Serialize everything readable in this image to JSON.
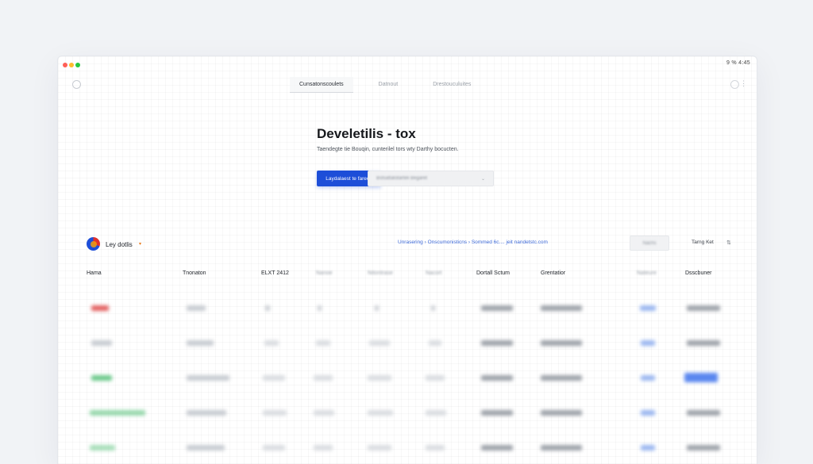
{
  "window": {
    "status_text": "9 %  4:45"
  },
  "topnav": {
    "tabs": [
      {
        "label": "Cunsatonscoulets",
        "active": true
      },
      {
        "label": "Datnout",
        "active": false
      },
      {
        "label": "Drestouculuites",
        "active": false
      }
    ]
  },
  "hero": {
    "title": "Develetilis - tox",
    "subtitle": "Taendegte tie Bouqin, cunterilel tors wty Darthy bocucten.",
    "primary_button": "Laydalaest te farech",
    "secondary_select": "Bstsattatotarteli Begaret"
  },
  "toolbar": {
    "title": "Ley dotlis",
    "breadcrumb": "Unrasering  ›  Onscumonisticns  ›  Sommed 6c....  jeit nandetstc.com",
    "button_label": "Nachs",
    "meta": "Tarng Ket",
    "meta_icon": "sort-icon"
  },
  "table": {
    "columns": [
      {
        "label": "Hama",
        "blurred": false
      },
      {
        "label": "Tnonaton",
        "blurred": false
      },
      {
        "label": "ELXT 2412",
        "blurred": false
      },
      {
        "label": "Nanoe",
        "blurred": true
      },
      {
        "label": "Nitontrase",
        "blurred": true
      },
      {
        "label": "Nacort",
        "blurred": true
      },
      {
        "label": "Dortall Sctum",
        "blurred": false
      },
      {
        "label": "Grentatior",
        "blurred": false
      },
      {
        "label": "Nateure",
        "blurred": true
      },
      {
        "label": "Dsscbuner",
        "blurred": false
      }
    ],
    "row_count": 5
  },
  "colors": {
    "accent": "#1d4ed8",
    "link": "#3f6bd9",
    "logo_red": "#e0312c",
    "logo_orange": "#f59e0b",
    "status_red": "#e36060",
    "status_green": "#6cc98b"
  }
}
